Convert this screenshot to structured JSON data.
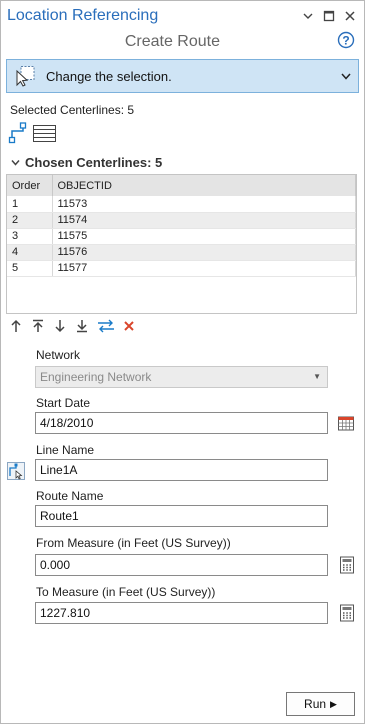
{
  "pane": {
    "title": "Location Referencing",
    "subtitle": "Create Route"
  },
  "window_controls": {
    "menu_icon": "chevron-down-icon",
    "maximize_icon": "maximize-icon",
    "close_icon": "close-icon"
  },
  "help_icon": "help-icon",
  "selection": {
    "label": "Change the selection.",
    "icon": "select-cursor-icon"
  },
  "selected_centerlines": "Selected Centerlines: 5",
  "chosen_section": {
    "title": "Chosen Centerlines: 5",
    "columns": [
      "Order",
      "OBJECTID"
    ],
    "rows": [
      [
        "1",
        "11573"
      ],
      [
        "2",
        "11574"
      ],
      [
        "3",
        "11575"
      ],
      [
        "4",
        "11576"
      ],
      [
        "5",
        "11577"
      ]
    ]
  },
  "row_tools": [
    "move-top-icon",
    "move-up-icon",
    "move-down-icon",
    "move-bottom-icon",
    "reverse-icon",
    "remove-icon"
  ],
  "form": {
    "network": {
      "label": "Network",
      "value": "Engineering Network"
    },
    "start_date": {
      "label": "Start Date",
      "value": "4/18/2010"
    },
    "line_name": {
      "label": "Line Name",
      "value": "Line1A"
    },
    "route_name": {
      "label": "Route Name",
      "value": "Route1"
    },
    "from_measure": {
      "label": "From Measure (in Feet (US Survey))",
      "value": "0.000"
    },
    "to_measure": {
      "label": "To Measure (in Feet (US Survey))",
      "value": "1227.810"
    }
  },
  "run_button": {
    "label": "Run"
  },
  "colors": {
    "title_blue": "#2a6ebb",
    "selection_bg": "#cfe4f5",
    "remove_red": "#d9452b"
  }
}
